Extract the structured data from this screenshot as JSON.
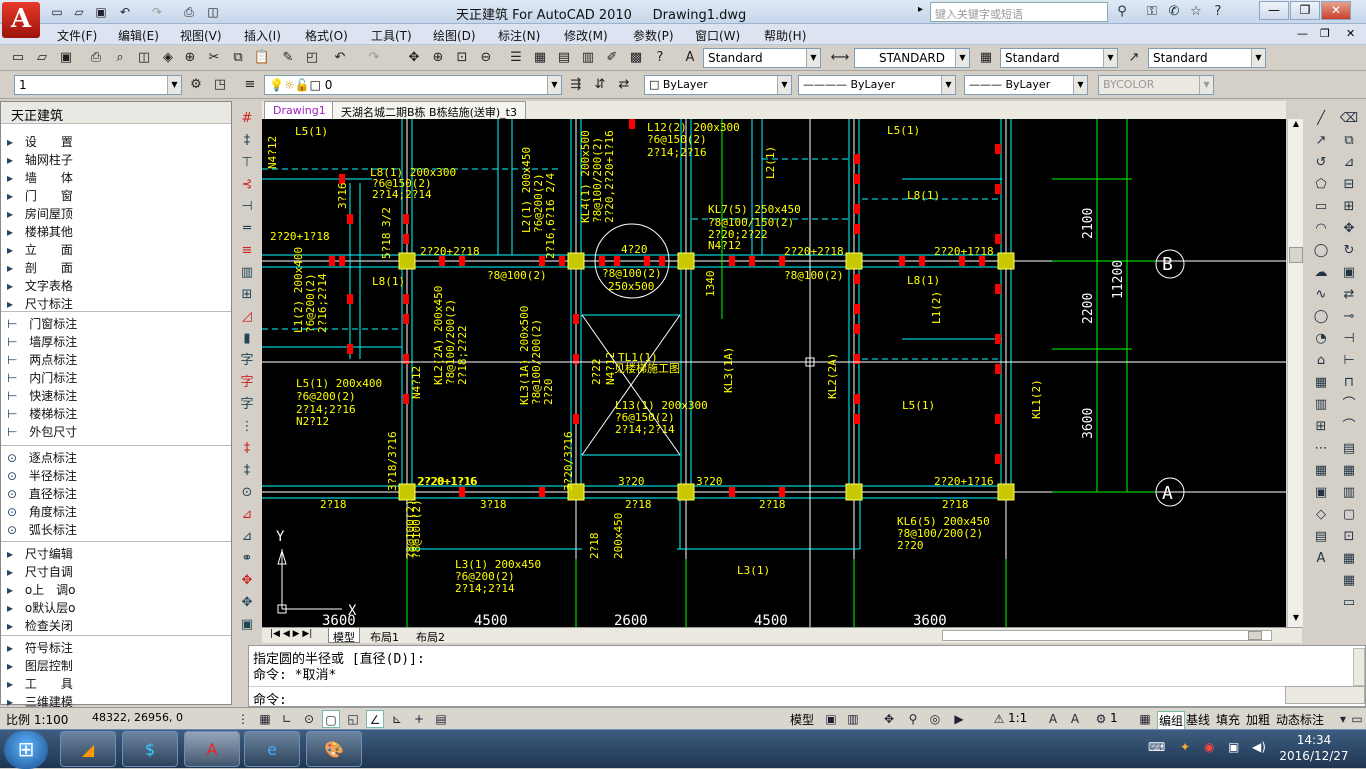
{
  "window": {
    "title": "天正建筑 For AutoCAD 2010",
    "doc": "Drawing1.dwg",
    "search_placeholder": "键入关键字或短语"
  },
  "logo_letter": "A",
  "menu": [
    "文件(F)",
    "编辑(E)",
    "视图(V)",
    "插入(I)",
    "格式(O)",
    "工具(T)",
    "绘图(D)",
    "标注(N)",
    "修改(M)",
    "参数(P)",
    "窗口(W)",
    "帮助(H)"
  ],
  "styles": {
    "text_style": "Standard",
    "dim_style": "STANDARD",
    "table_style": "Standard",
    "mleader_style": "Standard"
  },
  "layers": {
    "layer_number": "1",
    "current_layer": "0",
    "color": "ByLayer",
    "linetype": "ByLayer",
    "lineweight": "ByLayer",
    "plotstyle": "BYCOLOR"
  },
  "panel": {
    "title": "天正建筑",
    "group1": [
      "设　　置",
      "轴网柱子",
      "墙　　体",
      "门　　窗",
      "房间屋顶",
      "楼梯其他",
      "立　　面",
      "剖　　面",
      "文字表格",
      "尺寸标注"
    ],
    "group2": [
      "门窗标注",
      "墙厚标注",
      "两点标注",
      "内门标注",
      "快速标注",
      "楼梯标注",
      "外包尺寸"
    ],
    "group3": [
      "逐点标注",
      "半径标注",
      "直径标注",
      "角度标注",
      "弧长标注"
    ],
    "group4": [
      "尺寸编辑",
      "尺寸自调",
      "o上　调o",
      "o默认层o",
      "检查关闭"
    ],
    "group5": [
      "符号标注",
      "图层控制",
      "工　　具",
      "三维建模"
    ]
  },
  "doc_tabs": [
    "Drawing1",
    "天湖名城二期B栋 B栋结施(送审)_t3"
  ],
  "layout_tabs": [
    "模型",
    "布局1",
    "布局2"
  ],
  "drawing": {
    "labels": [
      "L5(1)",
      "N4?12",
      "L8(1) 200x300",
      "?6@150(2)",
      "2?14;2?14",
      "3?16",
      "2?20+1?18",
      "3/2",
      "5?18",
      "2?20+2?18",
      "?8@100(2)",
      "L1(2) 200x400",
      "?6@200(2)",
      "2?16;2?14",
      "L8(1)",
      "L2(1) 200x450",
      "?6@200(2)",
      "2?16,6?16 2/4",
      "KL4(1) 200x500",
      "?8@100/200(2)",
      "2?20,2?20+1?16",
      "L12(2) 200x300",
      "?6@150(2)",
      "2?14;2?16",
      "L2(1)",
      "4?20",
      "?8@100(2)",
      "250x500",
      "1340",
      "KL7(5) 250x450",
      "?8@100/150(2)",
      "2?20;2?22",
      "N4?12",
      "2?20+2?18",
      "?8@100(2)",
      "L5(1)",
      "L8(1)",
      "2?20+1?18",
      "L8(1)",
      "L1(2)",
      "L5(1) 200x400",
      "?6@200(2)",
      "2?14;2?16",
      "N2?12",
      "N4?12",
      "KL2(2A) 200x450",
      "?8@100/200(2)",
      "2?18;2?22",
      "KL3(1A) 200x500",
      "?8@100/200(2)",
      "2?20",
      "TL1(1)",
      "见楼梯施工图",
      "L13(1) 200x300",
      "?6@150(2)",
      "2?14;2?14",
      "KL3(1A)",
      "KL2(2A)",
      "L5(1)",
      "KL1(2)",
      "3?18/3?16",
      "3?20/3?16",
      "2?22",
      "N4?12",
      "2?20+1?16",
      "2?18",
      "2?20+1?16",
      "3?18",
      "3?20",
      "2?18",
      "3?20",
      "2?18",
      "2?20+1?16",
      "2?18",
      "?8@100(2)",
      "2?18",
      "?8@100(2)",
      "200x450",
      "L3(1) 200x450",
      "?6@200(2)",
      "2?14;2?14",
      "L3(1)",
      "KL6(5) 200x450",
      "?8@100/200(2)",
      "2?20"
    ],
    "dims_bottom": [
      "3600",
      "4500",
      "2600",
      "4500",
      "3600"
    ],
    "dims_right": [
      "2100",
      "2200",
      "3600",
      "11200"
    ],
    "axes": [
      "B",
      "A"
    ],
    "ucs": {
      "y": "Y",
      "x": "X"
    }
  },
  "command": {
    "line1": "指定圆的半径或 [直径(D)]:",
    "line2": "命令: *取消*",
    "prompt": "命令:"
  },
  "status": {
    "scale": "比例 1:100",
    "coords": "48322, 26956, 0",
    "model": "模型",
    "anno_scale": "1:1",
    "right_items": [
      "编组",
      "基线",
      "填充",
      "加粗",
      "动态标注"
    ],
    "ws": "1"
  },
  "clock": {
    "time": "14:34",
    "date": "2016/12/27"
  },
  "colors": {
    "canvas": "#000000",
    "beam_line": "#00ffff",
    "label": "#ffff00",
    "column": "#c8c800",
    "rebar": "#ff0000",
    "axis_line": "#00ff00",
    "white": "#ffffff"
  }
}
